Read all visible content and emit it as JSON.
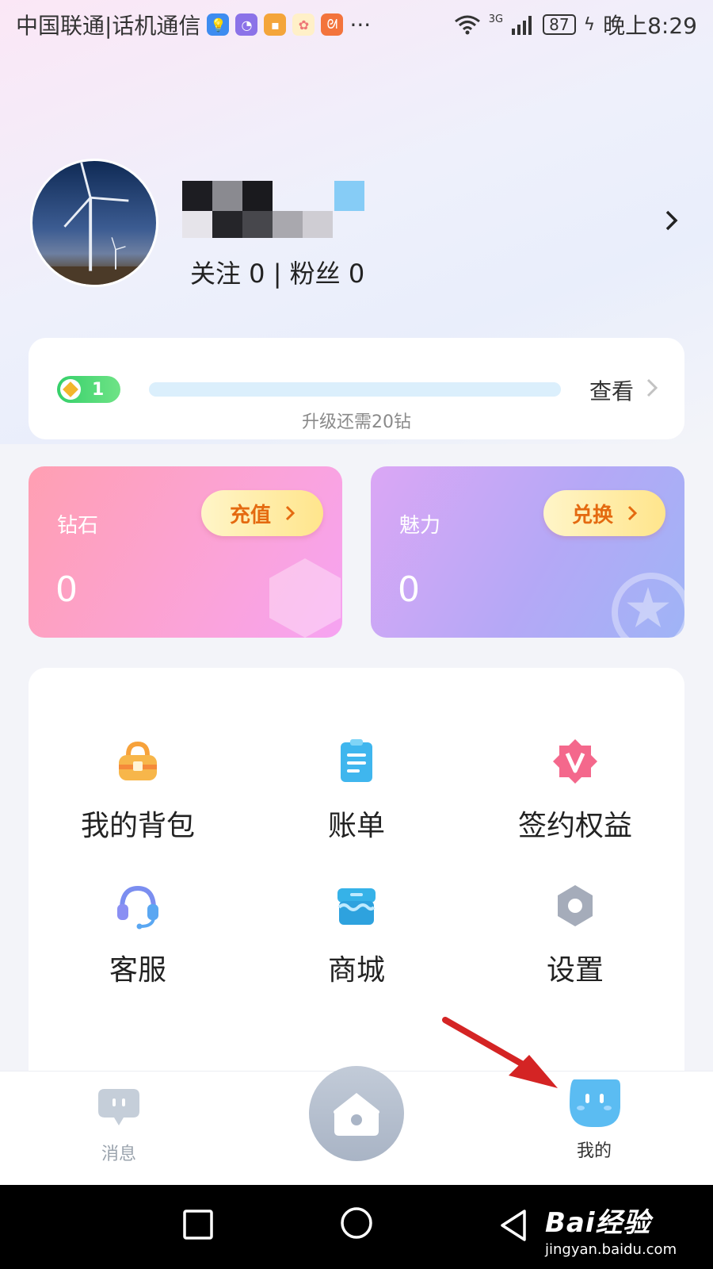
{
  "status_bar": {
    "carrier": "中国联通|话机通信",
    "more": "···",
    "network": "3G",
    "battery": "87",
    "time": "晚上8:29"
  },
  "profile": {
    "follow_text": "关注 0 | 粉丝 0"
  },
  "level": {
    "level_number": "1",
    "progress": 0.0,
    "upgrade_hint": "升级还需20钻",
    "view_label": "查看"
  },
  "wallet": {
    "diamond": {
      "label": "钻石",
      "value": "0",
      "button": "充值"
    },
    "charm": {
      "label": "魅力",
      "value": "0",
      "button": "兑换"
    }
  },
  "menu": {
    "items": [
      {
        "label": "我的背包",
        "icon": "backpack-icon"
      },
      {
        "label": "账单",
        "icon": "bill-icon"
      },
      {
        "label": "签约权益",
        "icon": "vip-badge-icon"
      },
      {
        "label": "客服",
        "icon": "headset-icon"
      },
      {
        "label": "商城",
        "icon": "shop-icon"
      },
      {
        "label": "设置",
        "icon": "settings-icon"
      }
    ]
  },
  "tab_bar": {
    "messages": "消息",
    "mine": "我的",
    "active": "mine"
  },
  "watermark": {
    "brand": "Bai经验",
    "url": "jingyan.baidu.com"
  },
  "colors": {
    "accent_orange": "#e46a10",
    "level_green": "#35d06a",
    "tab_active": "#5bbcf2"
  }
}
